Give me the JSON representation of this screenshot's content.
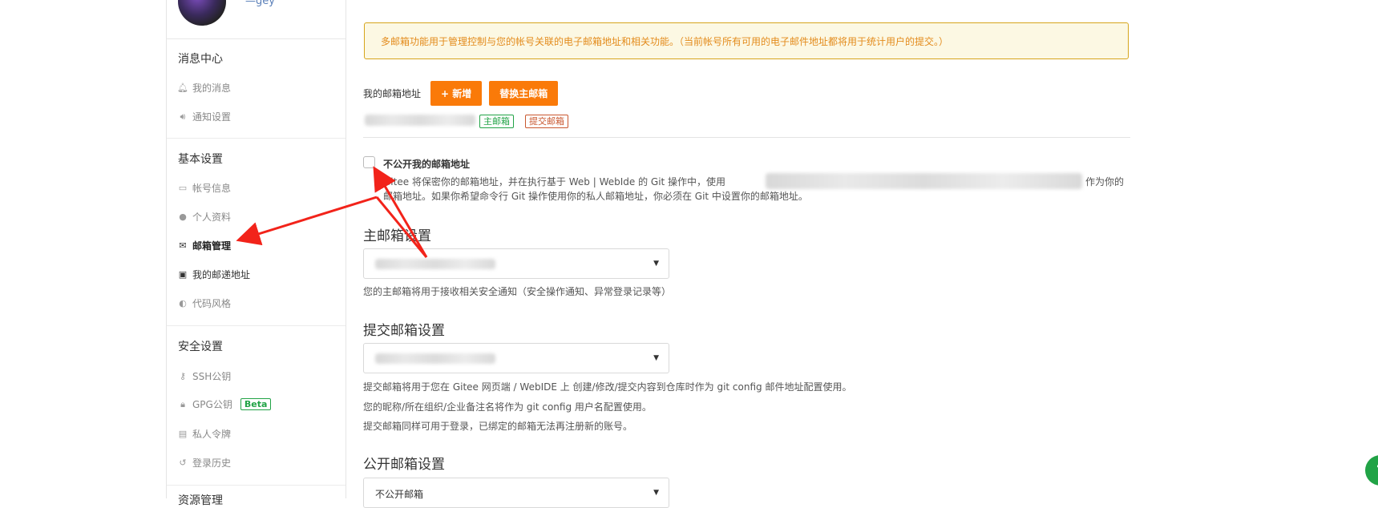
{
  "sidebar": {
    "user_name": "—gey",
    "groups": [
      {
        "title": "消息中心",
        "items": [
          {
            "label": "我的消息",
            "icon": "bell-icon"
          },
          {
            "label": "通知设置",
            "icon": "volume-icon"
          }
        ]
      },
      {
        "title": "基本设置",
        "items": [
          {
            "label": "帐号信息",
            "icon": "id-card-icon"
          },
          {
            "label": "个人资料",
            "icon": "user-icon"
          },
          {
            "label": "邮箱管理",
            "icon": "envelope-icon",
            "active": true
          },
          {
            "label": "我的邮递地址",
            "icon": "address-card-icon"
          },
          {
            "label": "代码风格",
            "icon": "palette-icon"
          }
        ]
      },
      {
        "title": "安全设置",
        "items": [
          {
            "label": "SSH公钥",
            "icon": "key-icon"
          },
          {
            "label": "GPG公钥",
            "icon": "lock-icon",
            "badge": "Beta"
          },
          {
            "label": "私人令牌",
            "icon": "briefcase-icon"
          },
          {
            "label": "登录历史",
            "icon": "history-icon"
          }
        ]
      },
      {
        "title": "资源管理"
      }
    ]
  },
  "main": {
    "notice": "多邮箱功能用于管理控制与您的帐号关联的电子邮箱地址和相关功能。（当前帐号所有可用的电子邮件地址都将用于统计用户的提交。）",
    "my_emails_label": "我的邮箱地址",
    "add_button": "+ 新增",
    "replace_button": "替换主邮箱",
    "tag_primary": "主邮箱",
    "tag_commit": "提交邮箱",
    "hide_email_label": "不公开我的邮箱地址",
    "hide_desc_1a": "Gitee 将保密你的邮箱地址，并在执行基于 Web | WebIde 的 Git 操作中，使用",
    "hide_desc_1b": "作为你的",
    "hide_desc_2": "邮箱地址。如果你希望命令行 Git 操作使用你的私人邮箱地址，你必须在 Git 中设置你的邮箱地址。",
    "primary_title": "主邮箱设置",
    "primary_hint": "您的主邮箱将用于接收相关安全通知（安全操作通知、异常登录记录等）",
    "commit_title": "提交邮箱设置",
    "commit_hint_1": "提交邮箱将用于您在 Gitee 网页端 / WebIDE 上 创建/修改/提交内容到仓库时作为 git config 邮件地址配置使用。",
    "commit_hint_2": "您的昵称/所在组织/企业备注名将作为 git config 用户名配置使用。",
    "commit_hint_3": "提交邮箱同样可用于登录，已绑定的邮箱无法再注册新的账号。",
    "public_title": "公开邮箱设置",
    "public_select_value": "不公开邮箱",
    "help": "?"
  },
  "colors": {
    "accent": "#fa7a09",
    "annotation": "#f2231a",
    "green": "#21a346"
  }
}
